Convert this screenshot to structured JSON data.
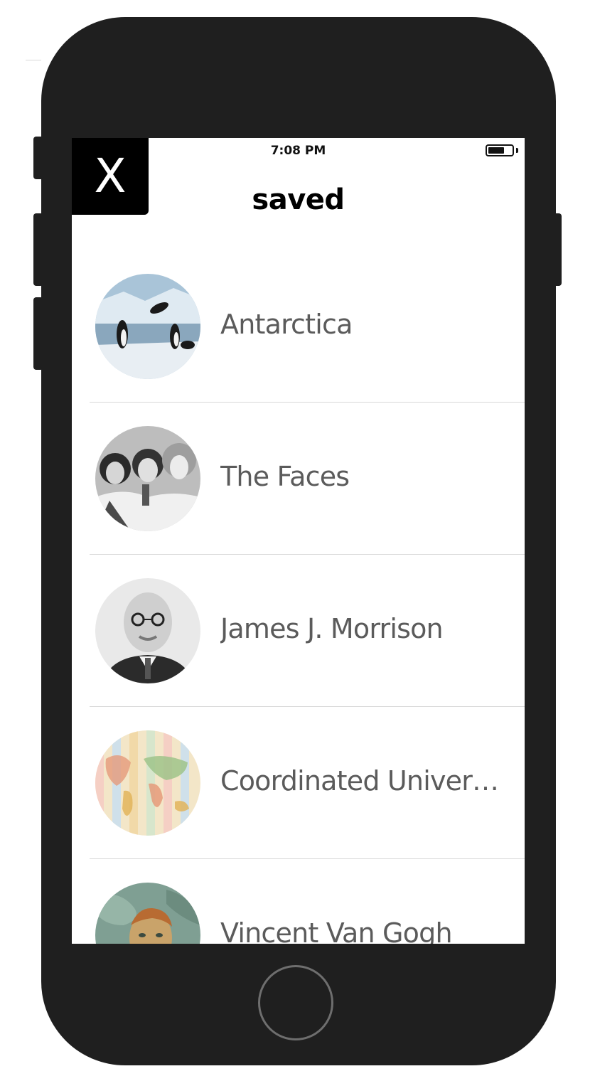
{
  "status_bar": {
    "time": "7:08 PM",
    "battery_level": 0.7
  },
  "header": {
    "close_label": "X",
    "title": "saved"
  },
  "saved_items": [
    {
      "label": "Antarctica",
      "thumbnail_icon": "penguins-photo"
    },
    {
      "label": "The Faces",
      "thumbnail_icon": "band-photo"
    },
    {
      "label": "James J. Morrison",
      "thumbnail_icon": "portrait-photo"
    },
    {
      "label": "Coordinated Univer…",
      "thumbnail_icon": "world-map-image"
    },
    {
      "label": "Vincent Van Gogh",
      "thumbnail_icon": "painting-image"
    }
  ],
  "colors": {
    "phone_body": "#1f1f1f",
    "close_button_bg": "#000000",
    "label_text": "#5b5b5b",
    "divider": "#d9d9d9"
  }
}
